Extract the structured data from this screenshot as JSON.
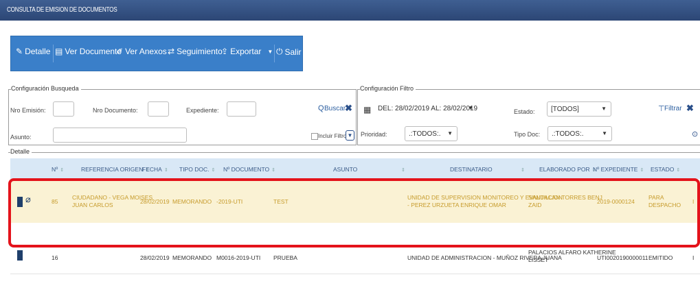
{
  "window": {
    "title": "CONSULTA DE EMISION DE DOCUMENTOS"
  },
  "toolbar": {
    "detalle": "Detalle",
    "ver_documento": "Ver Documento",
    "ver_anexos": "Ver Anexos",
    "seguimiento": "Seguimiento",
    "exportar": "Exportar",
    "salir": "Salir"
  },
  "busqueda": {
    "legend": "Configuración Busqueda",
    "nro_emision_label": "Nro Emisión:",
    "nro_documento_label": "Nro Documento:",
    "expediente_label": "Expediente:",
    "asunto_label": "Asunto:",
    "buscar": "Buscar",
    "incluir_filtro": "Incluir Filtro"
  },
  "filtro": {
    "legend": "Configuración Filtro",
    "fecha_range": "DEL: 28/02/2019 AL: 28/02/2019",
    "estado_label": "Estado:",
    "estado_value": "[TODOS]",
    "prioridad_label": "Prioridad:",
    "prioridad_value": ".:TODOS:.",
    "tipo_doc_label": "Tipo Doc:",
    "tipo_doc_value": ".:TODOS:.",
    "filtrar": "Filtrar"
  },
  "detalle": {
    "legend": "Detalle"
  },
  "table": {
    "columns": [
      "Nº",
      "REFERENCIA ORIGEN",
      "FECHA",
      "TIPO DOC.",
      "Nº DOCUMENTO",
      "ASUNTO",
      "DESTINATARIO",
      "ELABORADO POR",
      "Nº EXPEDIENTE",
      "ESTADO"
    ],
    "rows": [
      {
        "num": "85",
        "ref1": "CIUDADANO - VEGA MOISES",
        "ref2": "JUAN CARLOS",
        "fecha": "28/02/2019",
        "tipo": "MEMORANDO",
        "nro_doc": "-2019-UTI",
        "asunto": "TEST",
        "dest1": "UNIDAD DE SUPERVISION MONITOREO Y EVALUACION",
        "dest2": "- PEREZ URZUETA ENRIQUE OMAR",
        "elab1": "SANTILLAN TORRES BENJ",
        "elab2": "ZAID",
        "expediente": "2019-0000124",
        "estado1": "PARA",
        "estado2": "DESPACHO",
        "extra": "I"
      },
      {
        "num": "16",
        "ref1": "",
        "ref2": "",
        "fecha": "28/02/2019",
        "tipo": "MEMORANDO",
        "nro_doc": "M0016-2019-UTI",
        "asunto": "PRUEBA",
        "dest1": "UNIDAD DE ADMINISTRACION - MUÑOZ RIVERA JUANA",
        "dest2": "",
        "elab1": "PALACIOS ALFARO KATHERINE",
        "elab2": "LISSET",
        "expediente": "UTI0020190000011",
        "estado1": "EMITIDO",
        "estado2": "",
        "extra": "I"
      }
    ]
  }
}
